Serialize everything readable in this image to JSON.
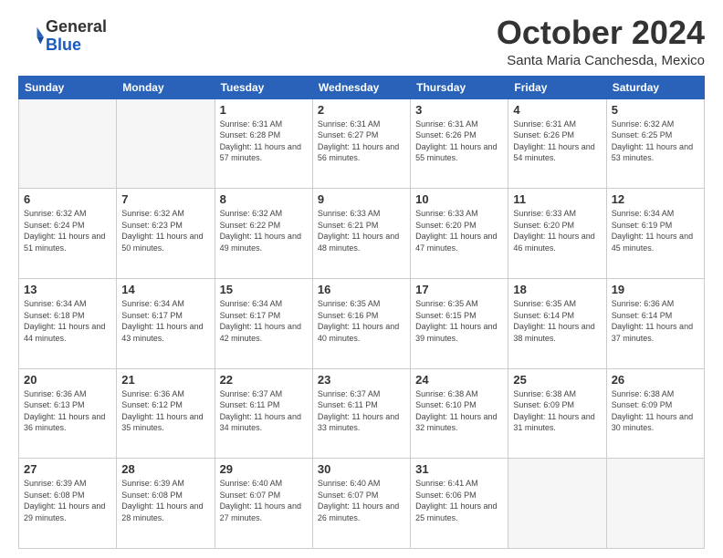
{
  "header": {
    "logo_line1": "General",
    "logo_line2": "Blue",
    "month": "October 2024",
    "location": "Santa Maria Canchesda, Mexico"
  },
  "weekdays": [
    "Sunday",
    "Monday",
    "Tuesday",
    "Wednesday",
    "Thursday",
    "Friday",
    "Saturday"
  ],
  "weeks": [
    [
      {
        "day": "",
        "empty": true
      },
      {
        "day": "",
        "empty": true
      },
      {
        "day": "1",
        "sunrise": "6:31 AM",
        "sunset": "6:28 PM",
        "daylight": "11 hours and 57 minutes."
      },
      {
        "day": "2",
        "sunrise": "6:31 AM",
        "sunset": "6:27 PM",
        "daylight": "11 hours and 56 minutes."
      },
      {
        "day": "3",
        "sunrise": "6:31 AM",
        "sunset": "6:26 PM",
        "daylight": "11 hours and 55 minutes."
      },
      {
        "day": "4",
        "sunrise": "6:31 AM",
        "sunset": "6:26 PM",
        "daylight": "11 hours and 54 minutes."
      },
      {
        "day": "5",
        "sunrise": "6:32 AM",
        "sunset": "6:25 PM",
        "daylight": "11 hours and 53 minutes."
      }
    ],
    [
      {
        "day": "6",
        "sunrise": "6:32 AM",
        "sunset": "6:24 PM",
        "daylight": "11 hours and 51 minutes."
      },
      {
        "day": "7",
        "sunrise": "6:32 AM",
        "sunset": "6:23 PM",
        "daylight": "11 hours and 50 minutes."
      },
      {
        "day": "8",
        "sunrise": "6:32 AM",
        "sunset": "6:22 PM",
        "daylight": "11 hours and 49 minutes."
      },
      {
        "day": "9",
        "sunrise": "6:33 AM",
        "sunset": "6:21 PM",
        "daylight": "11 hours and 48 minutes."
      },
      {
        "day": "10",
        "sunrise": "6:33 AM",
        "sunset": "6:20 PM",
        "daylight": "11 hours and 47 minutes."
      },
      {
        "day": "11",
        "sunrise": "6:33 AM",
        "sunset": "6:20 PM",
        "daylight": "11 hours and 46 minutes."
      },
      {
        "day": "12",
        "sunrise": "6:34 AM",
        "sunset": "6:19 PM",
        "daylight": "11 hours and 45 minutes."
      }
    ],
    [
      {
        "day": "13",
        "sunrise": "6:34 AM",
        "sunset": "6:18 PM",
        "daylight": "11 hours and 44 minutes."
      },
      {
        "day": "14",
        "sunrise": "6:34 AM",
        "sunset": "6:17 PM",
        "daylight": "11 hours and 43 minutes."
      },
      {
        "day": "15",
        "sunrise": "6:34 AM",
        "sunset": "6:17 PM",
        "daylight": "11 hours and 42 minutes."
      },
      {
        "day": "16",
        "sunrise": "6:35 AM",
        "sunset": "6:16 PM",
        "daylight": "11 hours and 40 minutes."
      },
      {
        "day": "17",
        "sunrise": "6:35 AM",
        "sunset": "6:15 PM",
        "daylight": "11 hours and 39 minutes."
      },
      {
        "day": "18",
        "sunrise": "6:35 AM",
        "sunset": "6:14 PM",
        "daylight": "11 hours and 38 minutes."
      },
      {
        "day": "19",
        "sunrise": "6:36 AM",
        "sunset": "6:14 PM",
        "daylight": "11 hours and 37 minutes."
      }
    ],
    [
      {
        "day": "20",
        "sunrise": "6:36 AM",
        "sunset": "6:13 PM",
        "daylight": "11 hours and 36 minutes."
      },
      {
        "day": "21",
        "sunrise": "6:36 AM",
        "sunset": "6:12 PM",
        "daylight": "11 hours and 35 minutes."
      },
      {
        "day": "22",
        "sunrise": "6:37 AM",
        "sunset": "6:11 PM",
        "daylight": "11 hours and 34 minutes."
      },
      {
        "day": "23",
        "sunrise": "6:37 AM",
        "sunset": "6:11 PM",
        "daylight": "11 hours and 33 minutes."
      },
      {
        "day": "24",
        "sunrise": "6:38 AM",
        "sunset": "6:10 PM",
        "daylight": "11 hours and 32 minutes."
      },
      {
        "day": "25",
        "sunrise": "6:38 AM",
        "sunset": "6:09 PM",
        "daylight": "11 hours and 31 minutes."
      },
      {
        "day": "26",
        "sunrise": "6:38 AM",
        "sunset": "6:09 PM",
        "daylight": "11 hours and 30 minutes."
      }
    ],
    [
      {
        "day": "27",
        "sunrise": "6:39 AM",
        "sunset": "6:08 PM",
        "daylight": "11 hours and 29 minutes."
      },
      {
        "day": "28",
        "sunrise": "6:39 AM",
        "sunset": "6:08 PM",
        "daylight": "11 hours and 28 minutes."
      },
      {
        "day": "29",
        "sunrise": "6:40 AM",
        "sunset": "6:07 PM",
        "daylight": "11 hours and 27 minutes."
      },
      {
        "day": "30",
        "sunrise": "6:40 AM",
        "sunset": "6:07 PM",
        "daylight": "11 hours and 26 minutes."
      },
      {
        "day": "31",
        "sunrise": "6:41 AM",
        "sunset": "6:06 PM",
        "daylight": "11 hours and 25 minutes."
      },
      {
        "day": "",
        "empty": true
      },
      {
        "day": "",
        "empty": true
      }
    ]
  ]
}
